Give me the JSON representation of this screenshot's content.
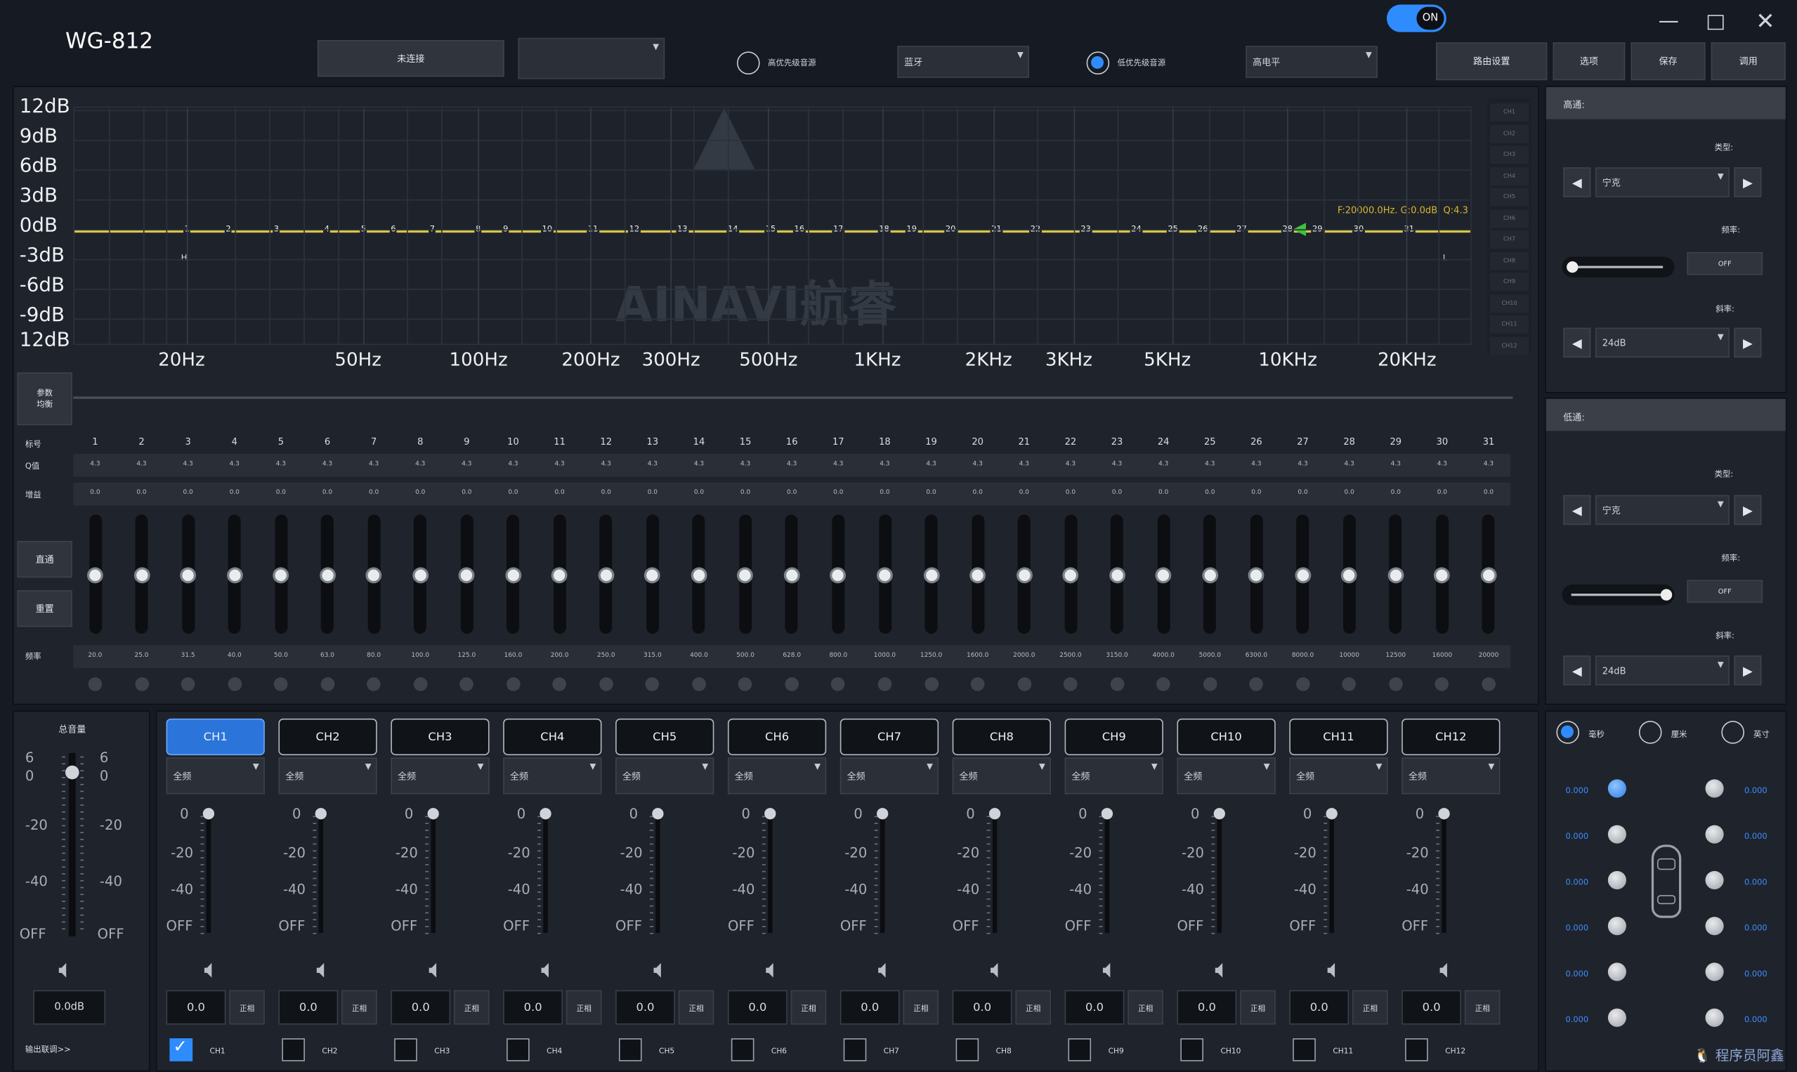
{
  "app": {
    "title": "WG-812",
    "toggle": "ON"
  },
  "header": {
    "connect": "未连接",
    "device_combo": "",
    "high_priority": "高优先级音源",
    "high_source": "蓝牙",
    "low_priority": "低优先级音源",
    "low_source": "高电平",
    "buttons": [
      "路由设置",
      "选项",
      "保存",
      "调用"
    ]
  },
  "graph": {
    "db_labels": [
      "12dB",
      "9dB",
      "6dB",
      "3dB",
      "0dB",
      "-3dB",
      "-6dB",
      "-9dB",
      "12dB"
    ],
    "freq_labels": [
      "20Hz",
      "50Hz",
      "100Hz",
      "200Hz",
      "300Hz",
      "500Hz",
      "1KHz",
      "2KHz",
      "3KHz",
      "5KHz",
      "10KHz",
      "20KHz"
    ],
    "info": "F:20000.0Hz. G:0.0dB. Q:4.3",
    "marker_h": "H",
    "marker_l": "L",
    "band_labels": [
      "1",
      "2",
      "3",
      "4",
      "5",
      "6",
      "7",
      "8",
      "9",
      "10",
      "11",
      "12",
      "13",
      "14",
      "15",
      "16",
      "17",
      "18",
      "19",
      "20",
      "21",
      "22",
      "23",
      "24",
      "25",
      "26",
      "27",
      "28",
      "29",
      "30",
      "31"
    ],
    "watermark": "AINAVI航睿",
    "channels": [
      "CH1",
      "CH2",
      "CH3",
      "CH4",
      "CH5",
      "CH6",
      "CH7",
      "CH8",
      "CH9",
      "CH10",
      "CH11",
      "CH12"
    ]
  },
  "eq": {
    "param_button": "参数\n均衡",
    "direct_button": "直通",
    "reset_button": "重置",
    "row_labels": {
      "index": "标号",
      "q": "Q值",
      "gain": "增益",
      "freq": "频率"
    },
    "index": [
      "1",
      "2",
      "3",
      "4",
      "5",
      "6",
      "7",
      "8",
      "9",
      "10",
      "11",
      "12",
      "13",
      "14",
      "15",
      "16",
      "17",
      "18",
      "19",
      "20",
      "21",
      "22",
      "23",
      "24",
      "25",
      "26",
      "27",
      "28",
      "29",
      "30",
      "31"
    ],
    "q": [
      "4.3",
      "4.3",
      "4.3",
      "4.3",
      "4.3",
      "4.3",
      "4.3",
      "4.3",
      "4.3",
      "4.3",
      "4.3",
      "4.3",
      "4.3",
      "4.3",
      "4.3",
      "4.3",
      "4.3",
      "4.3",
      "4.3",
      "4.3",
      "4.3",
      "4.3",
      "4.3",
      "4.3",
      "4.3",
      "4.3",
      "4.3",
      "4.3",
      "4.3",
      "4.3",
      "4.3"
    ],
    "gain": [
      "0.0",
      "0.0",
      "0.0",
      "0.0",
      "0.0",
      "0.0",
      "0.0",
      "0.0",
      "0.0",
      "0.0",
      "0.0",
      "0.0",
      "0.0",
      "0.0",
      "0.0",
      "0.0",
      "0.0",
      "0.0",
      "0.0",
      "0.0",
      "0.0",
      "0.0",
      "0.0",
      "0.0",
      "0.0",
      "0.0",
      "0.0",
      "0.0",
      "0.0",
      "0.0",
      "0.0"
    ],
    "freq": [
      "20.0",
      "25.0",
      "31.5",
      "40.0",
      "50.0",
      "63.0",
      "80.0",
      "100.0",
      "125.0",
      "160.0",
      "200.0",
      "250.0",
      "315.0",
      "400.0",
      "500.0",
      "628.0",
      "800.0",
      "1000.0",
      "1250.0",
      "1600.0",
      "2000.0",
      "2500.0",
      "3150.0",
      "4000.0",
      "5000.0",
      "6300.0",
      "8000.0",
      "10000",
      "12500",
      "16000",
      "20000"
    ]
  },
  "filters": {
    "high": {
      "title": "高通:",
      "type_label": "类型:",
      "type": "宁克",
      "freq_label": "频率:",
      "freq_value": "OFF",
      "slope_label": "斜率:",
      "slope": "24dB",
      "slider_level": 0.0
    },
    "low": {
      "title": "低通:",
      "type_label": "类型:",
      "type": "宁克",
      "freq_label": "频率:",
      "freq_value": "OFF",
      "slope_label": "斜率:",
      "slope": "24dB",
      "slider_level": 1.0
    }
  },
  "master": {
    "title": "总音量",
    "scale": [
      "6",
      "0",
      "-20",
      "-40",
      "OFF"
    ],
    "value": "0.0dB",
    "linkage": "输出联调>>"
  },
  "outputs": {
    "scale": [
      "0",
      "-20",
      "-40",
      "OFF"
    ],
    "channels": [
      {
        "name": "CH1",
        "mode": "全频",
        "value": "0.0",
        "phase": "正相",
        "check": "CH1",
        "checked": true
      },
      {
        "name": "CH2",
        "mode": "全频",
        "value": "0.0",
        "phase": "正相",
        "check": "CH2",
        "checked": false
      },
      {
        "name": "CH3",
        "mode": "全频",
        "value": "0.0",
        "phase": "正相",
        "check": "CH3",
        "checked": false
      },
      {
        "name": "CH4",
        "mode": "全频",
        "value": "0.0",
        "phase": "正相",
        "check": "CH4",
        "checked": false
      },
      {
        "name": "CH5",
        "mode": "全频",
        "value": "0.0",
        "phase": "正相",
        "check": "CH5",
        "checked": false
      },
      {
        "name": "CH6",
        "mode": "全频",
        "value": "0.0",
        "phase": "正相",
        "check": "CH6",
        "checked": false
      },
      {
        "name": "CH7",
        "mode": "全频",
        "value": "0.0",
        "phase": "正相",
        "check": "CH7",
        "checked": false
      },
      {
        "name": "CH8",
        "mode": "全频",
        "value": "0.0",
        "phase": "正相",
        "check": "CH8",
        "checked": false
      },
      {
        "name": "CH9",
        "mode": "全频",
        "value": "0.0",
        "phase": "正相",
        "check": "CH9",
        "checked": false
      },
      {
        "name": "CH10",
        "mode": "全频",
        "value": "0.0",
        "phase": "正相",
        "check": "CH10",
        "checked": false
      },
      {
        "name": "CH11",
        "mode": "全频",
        "value": "0.0",
        "phase": "正相",
        "check": "CH11",
        "checked": false
      },
      {
        "name": "CH12",
        "mode": "全频",
        "value": "0.0",
        "phase": "正相",
        "check": "CH12",
        "checked": false
      }
    ]
  },
  "delay": {
    "units": [
      "毫秒",
      "厘米",
      "英寸"
    ],
    "left_values": [
      "0.000",
      "0.000",
      "0.000",
      "0.000",
      "0.000",
      "0.000"
    ],
    "right_values": [
      "0.000",
      "0.000",
      "0.000",
      "0.000",
      "0.000",
      "0.000"
    ]
  },
  "brand": "程序员阿鑫"
}
